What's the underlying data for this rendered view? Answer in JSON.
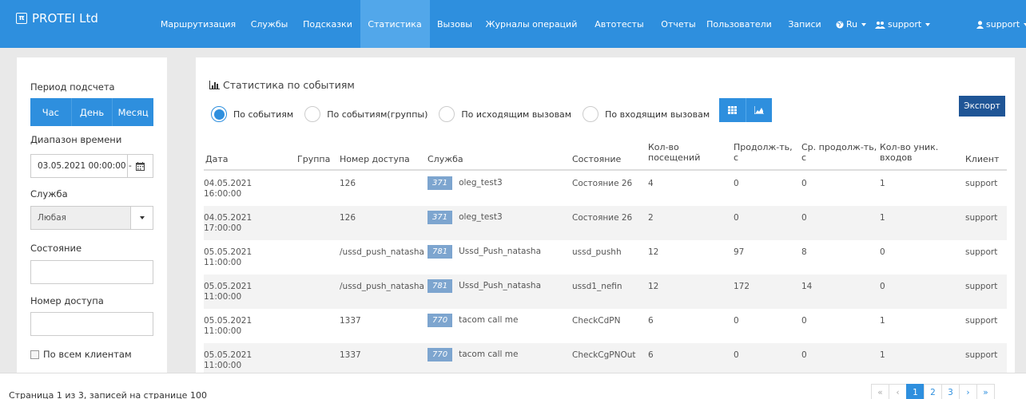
{
  "brand": {
    "logo": "π",
    "name": "PROTEI Ltd"
  },
  "nav": {
    "items": [
      "Маршрутизация",
      "Службы",
      "Подсказки",
      "Статистика",
      "Вызовы",
      "Журналы операций",
      "Автотесты",
      "Отчеты",
      "Пользователи",
      "Записи"
    ],
    "active": "Статистика",
    "lang": "Ru",
    "group": "support",
    "user": "support"
  },
  "filters": {
    "period_label": "Период подсчета",
    "period_buttons": [
      "Час",
      "День",
      "Месяц"
    ],
    "range_label": "Диапазон времени",
    "range_value": "03.05.2021 00:00:00 -",
    "service_label": "Служба",
    "service_value": "Любая",
    "state_label": "Состояние",
    "state_value": "",
    "access_label": "Номер доступа",
    "access_value": "",
    "all_clients_label": "По всем клиентам"
  },
  "main": {
    "title": "Статистика по событиям",
    "radios": [
      "По событиям",
      "По событиям(группы)",
      "По исходящим вызовам",
      "По входящим вызовам"
    ],
    "selected_radio": "По событиям",
    "export_label": "Экспорт"
  },
  "table": {
    "headers": {
      "date": "Дата",
      "group": "Группа",
      "access": "Номер доступа",
      "service": "Служба",
      "state": "Состояние",
      "visits_1": "Кол-во",
      "visits_2": "посещений",
      "duration_1": "Продолж-ть,",
      "duration_2": "с",
      "avg_1": "Ср. продолж-ть,",
      "avg_2": "с",
      "unique_1": "Кол-во уник.",
      "unique_2": "входов",
      "client": "Клиент"
    },
    "rows": [
      {
        "date1": "04.05.2021",
        "date2": "16:00:00",
        "group": "",
        "access": "126",
        "svc_id": "371",
        "svc_name": "oleg_test3",
        "state": "Состояние 26",
        "visits": "4",
        "duration": "0",
        "avg": "0",
        "unique": "1",
        "client": "support"
      },
      {
        "date1": "04.05.2021",
        "date2": "17:00:00",
        "group": "",
        "access": "126",
        "svc_id": "371",
        "svc_name": "oleg_test3",
        "state": "Состояние 26",
        "visits": "2",
        "duration": "0",
        "avg": "0",
        "unique": "1",
        "client": "support"
      },
      {
        "date1": "05.05.2021",
        "date2": "11:00:00",
        "group": "",
        "access": "/ussd_push_natasha",
        "svc_id": "781",
        "svc_name": "Ussd_Push_natasha",
        "state": "ussd_pushh",
        "visits": "12",
        "duration": "97",
        "avg": "8",
        "unique": "0",
        "client": "support"
      },
      {
        "date1": "05.05.2021",
        "date2": "11:00:00",
        "group": "",
        "access": "/ussd_push_natasha",
        "svc_id": "781",
        "svc_name": "Ussd_Push_natasha",
        "state": "ussd1_nefin",
        "visits": "12",
        "duration": "172",
        "avg": "14",
        "unique": "0",
        "client": "support"
      },
      {
        "date1": "05.05.2021",
        "date2": "11:00:00",
        "group": "",
        "access": "1337",
        "svc_id": "770",
        "svc_name": "tacom call me",
        "state": "CheckCdPN",
        "visits": "6",
        "duration": "0",
        "avg": "0",
        "unique": "1",
        "client": "support"
      },
      {
        "date1": "05.05.2021",
        "date2": "11:00:00",
        "group": "",
        "access": "1337",
        "svc_id": "770",
        "svc_name": "tacom call me",
        "state": "CheckCgPNOut",
        "visits": "6",
        "duration": "0",
        "avg": "0",
        "unique": "1",
        "client": "support"
      }
    ]
  },
  "footer": {
    "summary": "Страница 1 из 3, записей на странице 100",
    "pager": {
      "first": "«",
      "prev": "‹",
      "pages": [
        "1",
        "2",
        "3"
      ],
      "current": "1",
      "next": "›",
      "last": "»"
    }
  },
  "colors": {
    "primary": "#2e8fde",
    "nav_active": "#52a7ea",
    "export": "#1f5596",
    "badge": "#7da5cf"
  }
}
